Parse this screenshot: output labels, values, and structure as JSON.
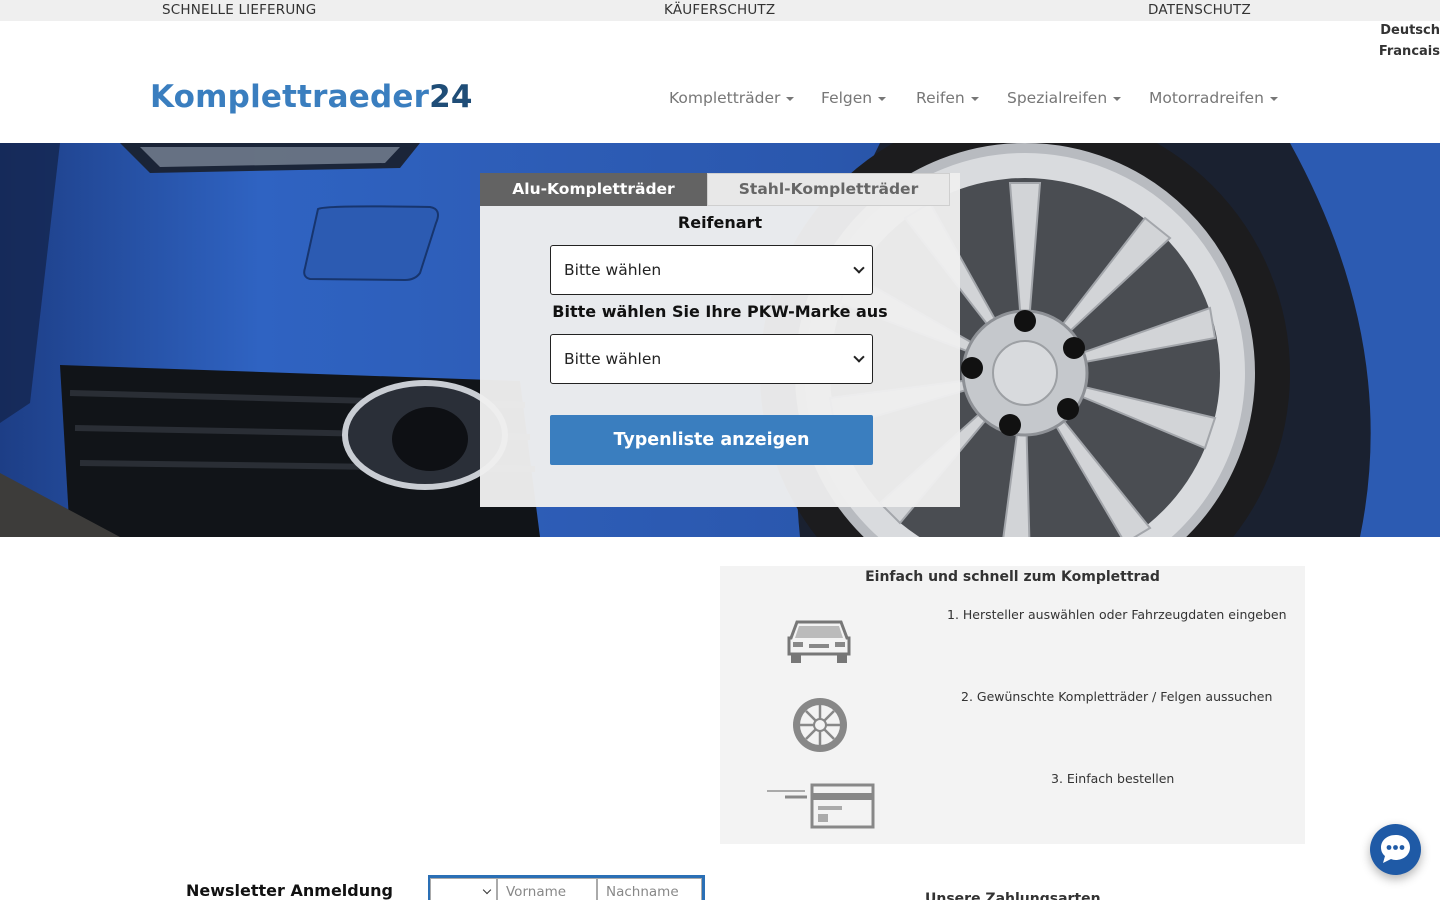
{
  "topbar": {
    "items": [
      "SCHNELLE LIEFERUNG",
      "KÄUFERSCHUTZ",
      "DATENSCHUTZ"
    ]
  },
  "languages": [
    "Deutsch",
    "Francais"
  ],
  "logo": {
    "part1": "Komplettraeder",
    "part2": "24"
  },
  "nav": {
    "items": [
      "Kompletträder",
      "Felgen",
      "Reifen",
      "Spezialreifen",
      "Motorradreifen"
    ]
  },
  "search": {
    "tabs": [
      "Alu-Kompletträder",
      "Stahl-Kompletträder"
    ],
    "active_tab": "Alu-Kompletträder",
    "tire_type_label": "Reifenart",
    "tire_type_value": "Bitte wählen",
    "brand_label": "Bitte wählen Sie Ihre PKW-Marke aus",
    "brand_value": "Bitte wählen",
    "submit_label": "Typenliste anzeigen"
  },
  "steps": {
    "title": "Einfach und schnell zum Komplettrad",
    "items": [
      {
        "text": "1. Hersteller auswählen oder Fahrzeugdaten eingeben",
        "icon": "car-icon"
      },
      {
        "text": "2. Gewünschte Kompletträder / Felgen aussuchen",
        "icon": "wheel-icon"
      },
      {
        "text": "3. Einfach bestellen",
        "icon": "credit-card-icon"
      }
    ]
  },
  "newsletter": {
    "title": "Newsletter Anmeldung",
    "firstname_placeholder": "Vorname",
    "lastname_placeholder": "Nachname"
  },
  "payment": {
    "title": "Unsere Zahlungsarten"
  },
  "colors": {
    "brand_blue": "#3a7ebf",
    "brand_dark": "#1f4d77",
    "tab_active": "#636363",
    "chat": "#1f5aa6"
  }
}
